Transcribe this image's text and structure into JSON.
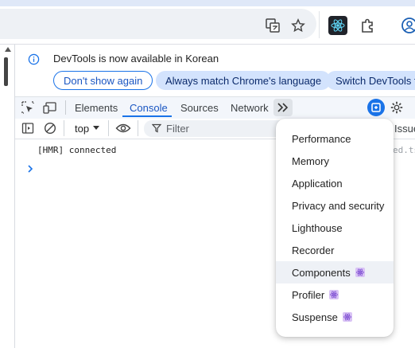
{
  "infobar": {
    "message": "DevTools is now available in Korean",
    "dont_show": "Don't show again",
    "match_language": "Always match Chrome's language",
    "switch": "Switch DevTools to"
  },
  "tabs": [
    "Elements",
    "Console",
    "Sources",
    "Network"
  ],
  "console_toolbar": {
    "context": "top",
    "filter_placeholder": "Filter",
    "issues": "Issue"
  },
  "log": {
    "message": "[HMR] connected",
    "source": "ed.ts"
  },
  "menu": {
    "items": [
      "Performance",
      "Memory",
      "Application",
      "Privacy and security",
      "Lighthouse",
      "Recorder",
      "Components",
      "Profiler",
      "Suspense"
    ]
  },
  "colors": {
    "accent": "#1a73e8",
    "pill_bg": "#d3e3fd",
    "react_blue": "#1a5fb4"
  }
}
